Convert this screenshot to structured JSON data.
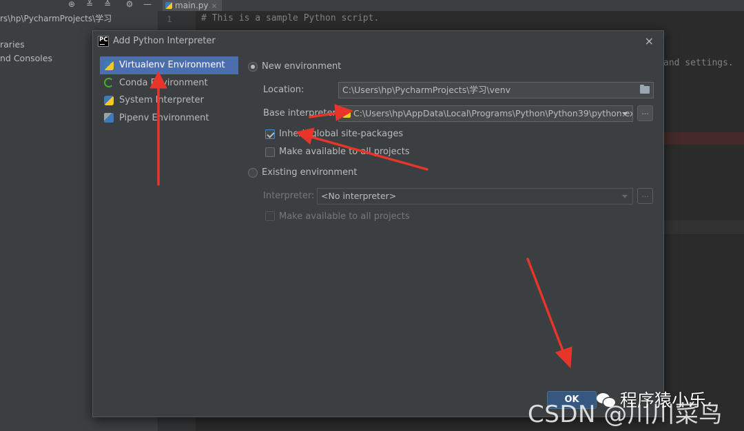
{
  "ide": {
    "project_path": "rs\\hp\\PycharmProjects\\学习",
    "tree_items": [
      "raries",
      "nd Consoles"
    ],
    "toolbar_icons": [
      "globe-icon",
      "collapse-icon",
      "expand-icon",
      "gear-icon",
      "minimize-icon"
    ],
    "tab_label": "main.py",
    "tab_close": "×",
    "line_number": "1",
    "code_line_1": "# This is a sample Python script.",
    "code_fragment": "and settings."
  },
  "dialog": {
    "title": "Add Python Interpreter",
    "close": "×",
    "environments": [
      {
        "label": "Virtualenv Environment",
        "icon": "python-icon",
        "selected": true
      },
      {
        "label": "Conda Environment",
        "icon": "conda-icon",
        "selected": false
      },
      {
        "label": "System Interpreter",
        "icon": "python-icon",
        "selected": false
      },
      {
        "label": "Pipenv Environment",
        "icon": "pipenv-icon",
        "selected": false
      }
    ],
    "new_env": {
      "label": "New environment",
      "selected": true,
      "location_label": "Location:",
      "location_value": "C:\\Users\\hp\\PycharmProjects\\学习\\venv",
      "base_label": "Base interpreter:",
      "base_value": "C:\\Users\\hp\\AppData\\Local\\Programs\\Python\\Python39\\python.ex",
      "browse_label": "...",
      "inherit_label": "Inherit global site-packages",
      "inherit_checked": true,
      "make_available_label": "Make available to all projects",
      "make_available_checked": false
    },
    "existing_env": {
      "label": "Existing environment",
      "selected": false,
      "interpreter_label": "Interpreter:",
      "interpreter_value": "<No interpreter>",
      "browse_label": "...",
      "make_available_label": "Make available to all projects"
    },
    "ok_label": "OK"
  },
  "watermark": {
    "wechat": "程序猿小乐",
    "csdn": "CSDN @川川菜鸟"
  },
  "colors": {
    "selection": "#4b6eaf",
    "arrow": "#e8352a",
    "ok_button": "#365880"
  }
}
